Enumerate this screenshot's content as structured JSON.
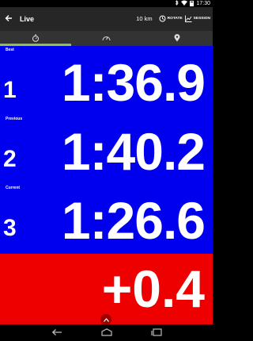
{
  "status_bar": {
    "time": "17:30",
    "icons": [
      "bluetooth-icon",
      "wifi-icon",
      "battery-icon"
    ]
  },
  "toolbar": {
    "title": "Live",
    "distance": "10 km",
    "rotate_label": "ROTATE",
    "session_label": "SESSION",
    "icons": [
      "back-arrow-icon",
      "rotate-icon",
      "session-chart-icon"
    ]
  },
  "tabs": [
    {
      "icon": "stopwatch-icon",
      "active": true
    },
    {
      "icon": "speedometer-icon",
      "active": false
    },
    {
      "icon": "location-pin-icon",
      "active": false
    }
  ],
  "rows": [
    {
      "label": "Best",
      "position": "1",
      "time": "1:36.9"
    },
    {
      "label": "Previous",
      "position": "2",
      "time": "1:40.2"
    },
    {
      "label": "Current",
      "position": "3",
      "time": "1:26.6"
    }
  ],
  "delta": "+0.4",
  "colors": {
    "lap_panel": "#0000ee",
    "delta_panel": "#ee0000",
    "tab_indicator": "#8bc34a",
    "toolbar": "#262626"
  },
  "nav_bar": {
    "icons": [
      "back-nav-icon",
      "home-nav-icon",
      "recents-nav-icon"
    ]
  }
}
